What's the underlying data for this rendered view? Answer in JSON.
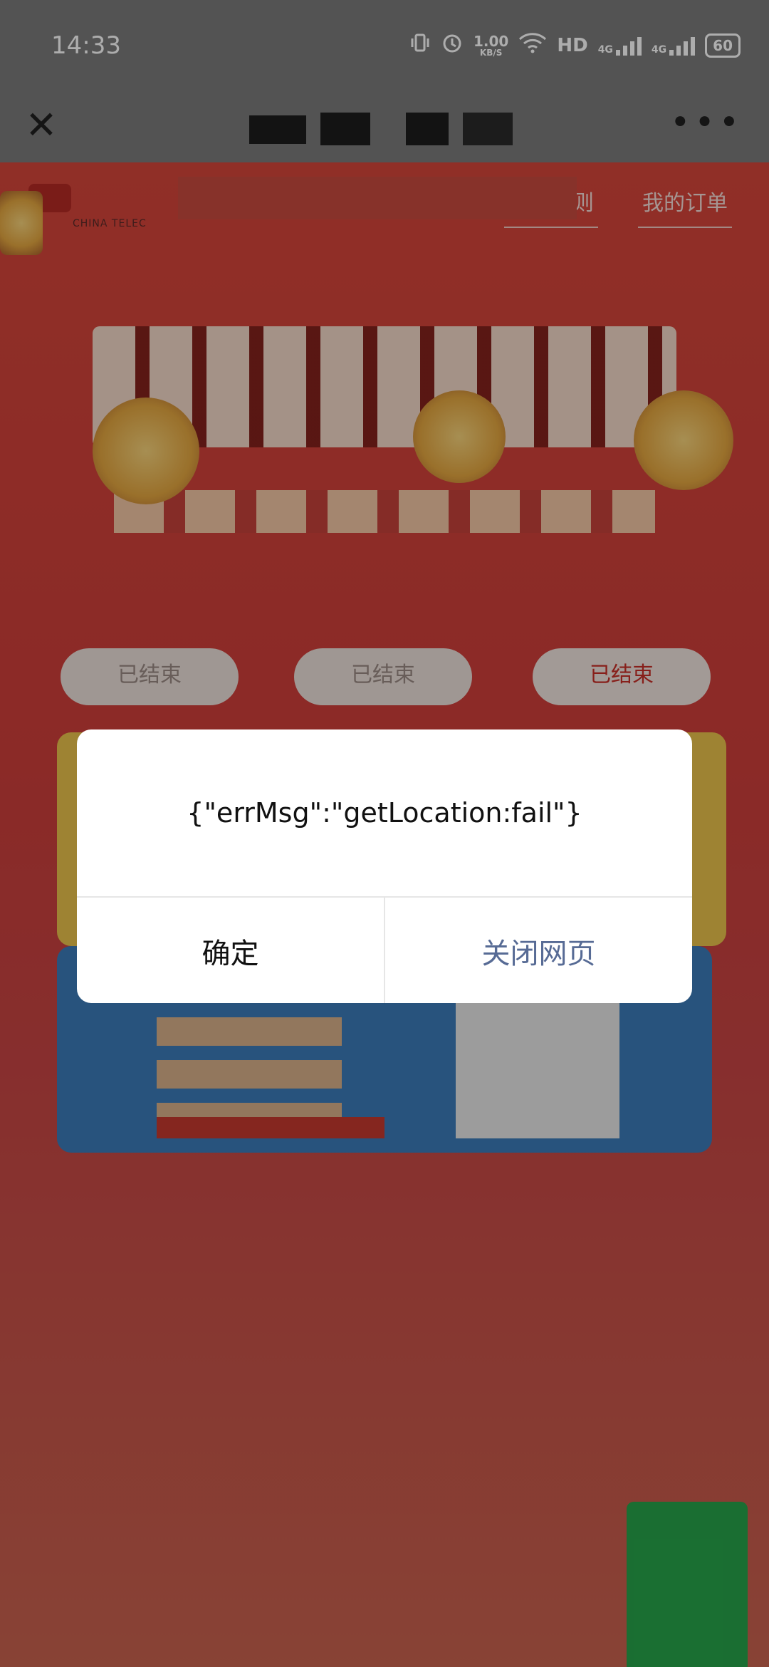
{
  "status_bar": {
    "time": "14:33",
    "net_speed_value": "1.00",
    "net_speed_unit": "KB/S",
    "hd_label": "HD",
    "net_4g_1": "4G",
    "net_4g_2": "4G",
    "battery": "60"
  },
  "nav_bar": {
    "close_icon": "close-icon",
    "more_icon": "more-icon"
  },
  "page": {
    "brand_text": "CHINA TELEC",
    "link_rules": "活动规则",
    "link_orders": "我的订单",
    "tabs": [
      {
        "label": "已结束"
      },
      {
        "label": "已结束"
      },
      {
        "label": "已结束"
      }
    ],
    "colors": {
      "page_red": "#d5463a",
      "card_yellow": "#e9c24c",
      "card_blue": "#3b7bb8",
      "float_green": "#27a34a"
    }
  },
  "dialog": {
    "message": "{\"errMsg\":\"getLocation:fail\"}",
    "confirm_label": "确定",
    "close_page_label": "关闭网页"
  }
}
